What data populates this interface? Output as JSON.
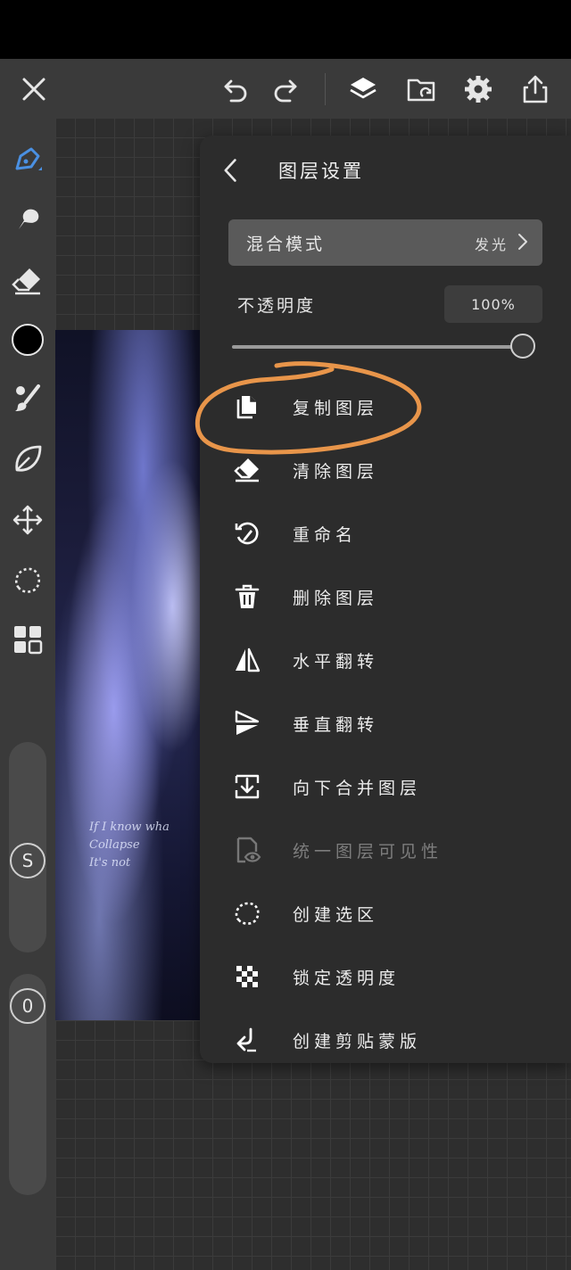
{
  "toolbar": {
    "left_icons": [
      "close-icon"
    ],
    "center_icons": [
      "undo-icon",
      "redo-icon"
    ],
    "right_icons": [
      "layers-icon",
      "gallery-import-icon",
      "settings-gear-icon",
      "share-export-icon"
    ]
  },
  "tools": [
    "pen-brush-icon",
    "smudge-icon",
    "eraser-icon",
    "color-swatch-icon",
    "brush-settings-icon",
    "leaf-fill-icon",
    "move-transform-icon",
    "lasso-select-icon",
    "grid-menu-icon"
  ],
  "colors": {
    "active_tool": "#4a90e2",
    "current_color": "#000000",
    "annotation": "#e8954a"
  },
  "sliders": {
    "size_badge": "S",
    "opacity_badge": "0"
  },
  "artwork": {
    "lines": [
      "If I know wha",
      "Collapse",
      "It's not"
    ]
  },
  "panel": {
    "title": "图层设置",
    "blend_mode_label": "混合模式",
    "blend_mode_value": "发光",
    "opacity_label": "不透明度",
    "opacity_value": "100%",
    "opacity_level": 1.0,
    "items": [
      {
        "label": "复制图层",
        "icon": "duplicate-layer-icon",
        "enabled": true
      },
      {
        "label": "清除图层",
        "icon": "eraser-clear-icon",
        "enabled": true
      },
      {
        "label": "重命名",
        "icon": "rename-icon",
        "enabled": true
      },
      {
        "label": "删除图层",
        "icon": "trash-icon",
        "enabled": true
      },
      {
        "label": "水平翻转",
        "icon": "flip-horizontal-icon",
        "enabled": true
      },
      {
        "label": "垂直翻转",
        "icon": "flip-vertical-icon",
        "enabled": true
      },
      {
        "label": "向下合并图层",
        "icon": "merge-down-icon",
        "enabled": true
      },
      {
        "label": "统一图层可见性",
        "icon": "visibility-icon",
        "enabled": false
      },
      {
        "label": "创建选区",
        "icon": "selection-icon",
        "enabled": true
      },
      {
        "label": "锁定透明度",
        "icon": "lock-transparency-icon",
        "enabled": true
      },
      {
        "label": "创建剪贴蒙版",
        "icon": "clipping-mask-icon",
        "enabled": true
      }
    ]
  }
}
